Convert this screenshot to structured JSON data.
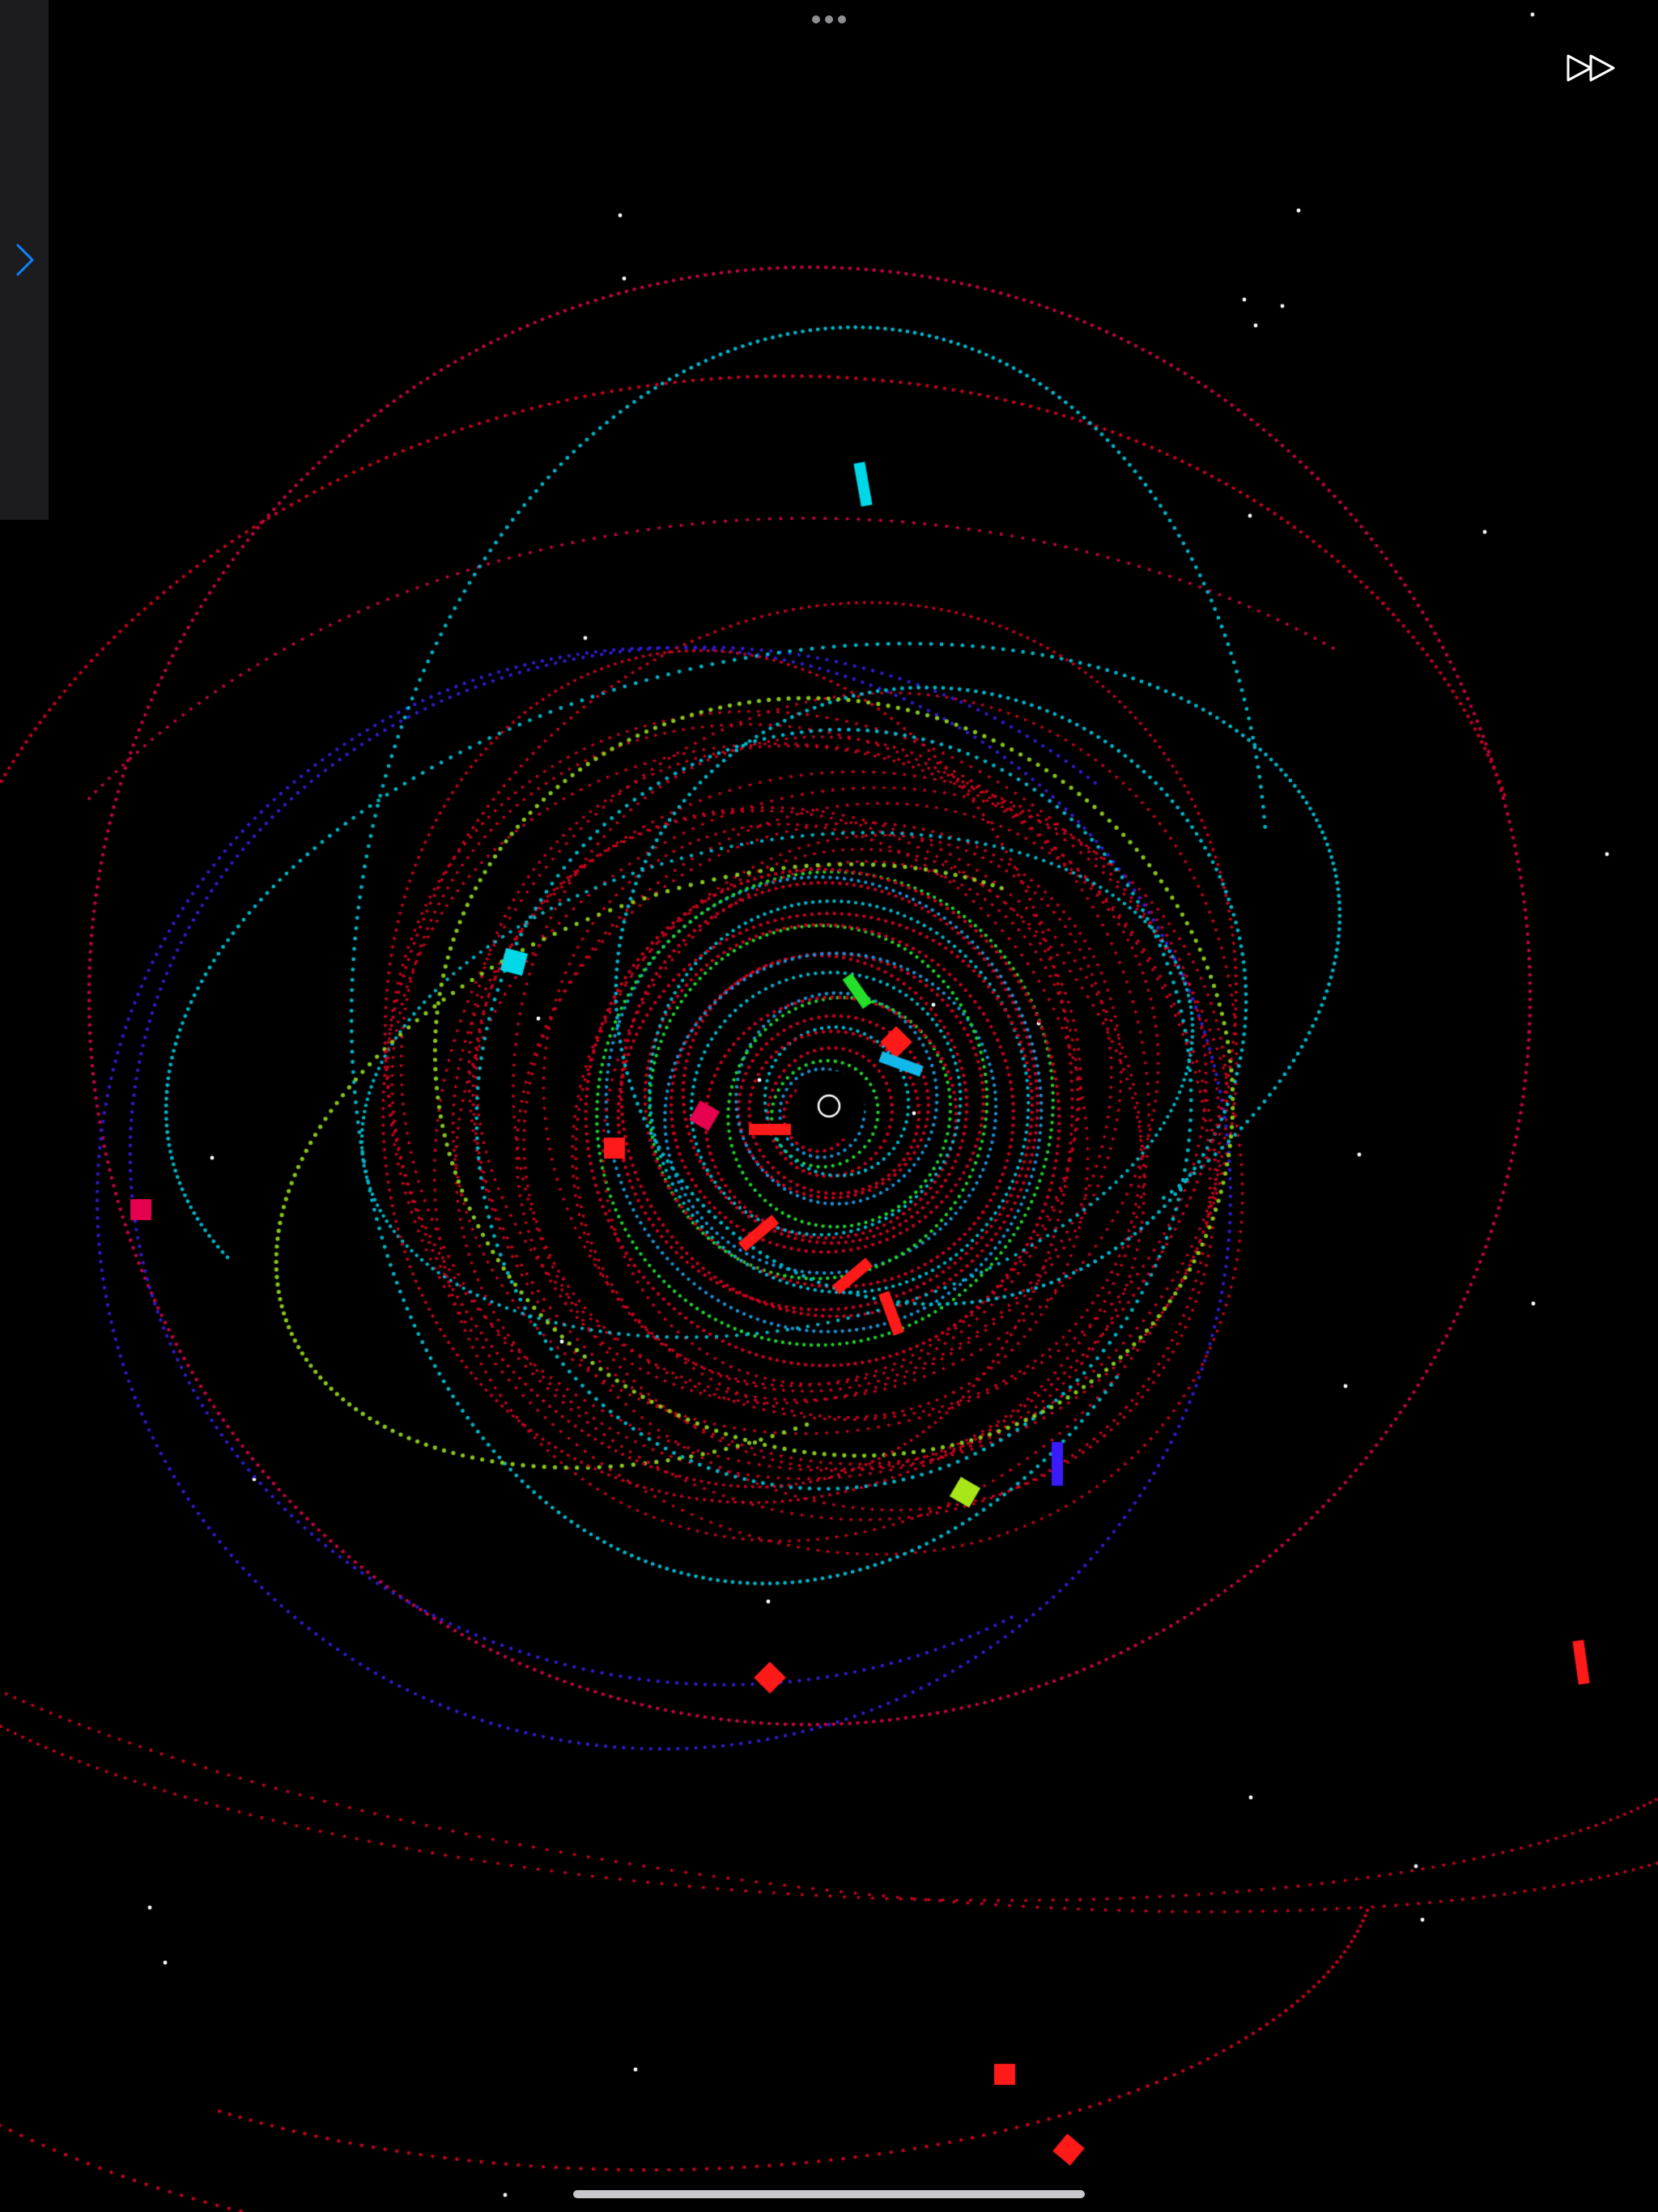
{
  "app": {
    "name": "orbit-simulation"
  },
  "controls": {
    "sidebar_toggle_icon": "chevron-right-icon",
    "more_icon": "more-horizontal-icon",
    "fast_forward_icon": "fast-forward-icon"
  },
  "scene": {
    "center_body": "central-star-outline",
    "colors": {
      "background": "#000000",
      "panel": "#1c1c1e",
      "accent": "#0a84ff",
      "star": "#ffffff"
    },
    "trail_colors": [
      "#c8001e",
      "#c8004a",
      "#00b4c8",
      "#2e1ccc",
      "#86c51a",
      "#1fcf2a",
      "#1a8fd0"
    ],
    "body_colors": [
      "#ff1a1a",
      "#e60050",
      "#00d8e8",
      "#3a1aff",
      "#a8e61a",
      "#25e02a",
      "#12b8ea"
    ]
  }
}
